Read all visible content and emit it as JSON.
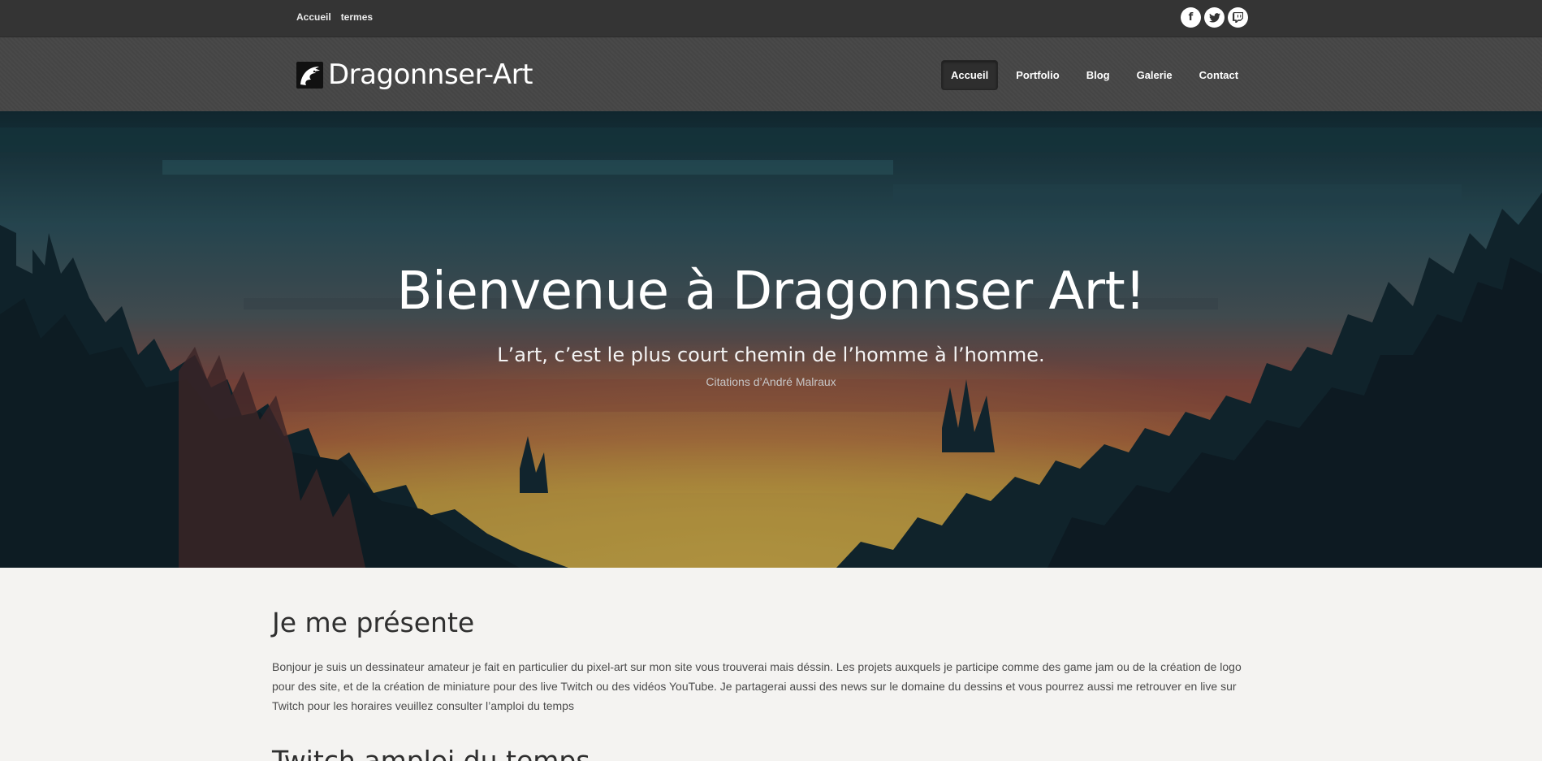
{
  "topbar": {
    "links": [
      "Accueil",
      "termes"
    ],
    "social": [
      {
        "icon": "facebook-icon",
        "glyph": "f"
      },
      {
        "icon": "twitter-icon",
        "glyph": "t"
      },
      {
        "icon": "twitch-icon",
        "glyph": "▣"
      }
    ]
  },
  "header": {
    "brand": "Dragonnser-Art",
    "nav": [
      "Accueil",
      "Portfolio",
      "Blog",
      "Galerie",
      "Contact"
    ],
    "active_nav": "Accueil"
  },
  "hero": {
    "title": "Bienvenue à Dragonnser Art!",
    "quote": "L’art, c’est le plus court chemin de l’homme à l’homme.",
    "author": "Citations d’André Malraux"
  },
  "about": {
    "title": "Je me présente",
    "text": "Bonjour je suis un dessinateur amateur je fait en particulier du pixel-art sur mon site vous trouverai mais déssin.  Les projets auxquels je participe comme des game jam ou de la création de logo pour des site, et de la création de miniature pour des live Twitch ou des vidéos YouTube.   Je partagerai aussi des news sur le domaine du dessins et vous pourrez aussi me retrouver en live sur Twitch pour les horaires veuillez consulter l’amploi du temps"
  },
  "schedule": {
    "title": "Twitch amploi du temps"
  }
}
